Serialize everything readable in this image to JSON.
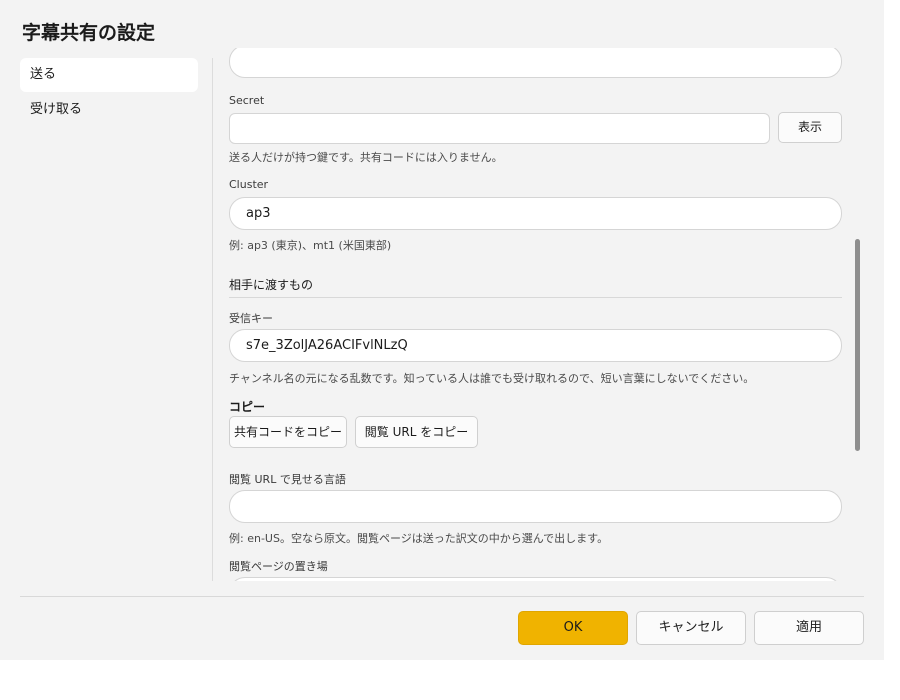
{
  "dialog": {
    "title": "字幕共有の設定"
  },
  "sidebar": {
    "items": [
      {
        "label": "送る",
        "active": true
      },
      {
        "label": "受け取る",
        "active": false
      }
    ]
  },
  "send": {
    "secret": {
      "label": "Secret",
      "value": "",
      "toggle_label": "表示",
      "hint": "送る人だけが持つ鍵です。共有コードには入りません。"
    },
    "cluster": {
      "label": "Cluster",
      "value": "ap3",
      "hint": "例: ap3 (東京)、mt1 (米国東部)"
    },
    "share_section": {
      "title": "相手に渡すもの",
      "receive_key": {
        "label": "受信キー",
        "value": "s7e_3ZolJA26ACIFvlNLzQ",
        "hint": "チャンネル名の元になる乱数です。知っている人は誰でも受け取れるので、短い言葉にしないでください。"
      },
      "copy": {
        "heading": "コピー",
        "share_code_button": "共有コードをコピー",
        "view_url_button": "閲覧 URL をコピー"
      },
      "view_language": {
        "label": "閲覧 URL で見せる言語",
        "value": "",
        "hint": "例: en-US。空なら原文。閲覧ページは送った訳文の中から選んで出します。"
      },
      "view_location": {
        "label": "閲覧ページの置き場"
      }
    }
  },
  "footer": {
    "ok": "OK",
    "cancel": "キャンセル",
    "apply": "適用"
  },
  "colors": {
    "dialog_bg": "#f3f3f3",
    "primary_accent": "#f0b300"
  }
}
